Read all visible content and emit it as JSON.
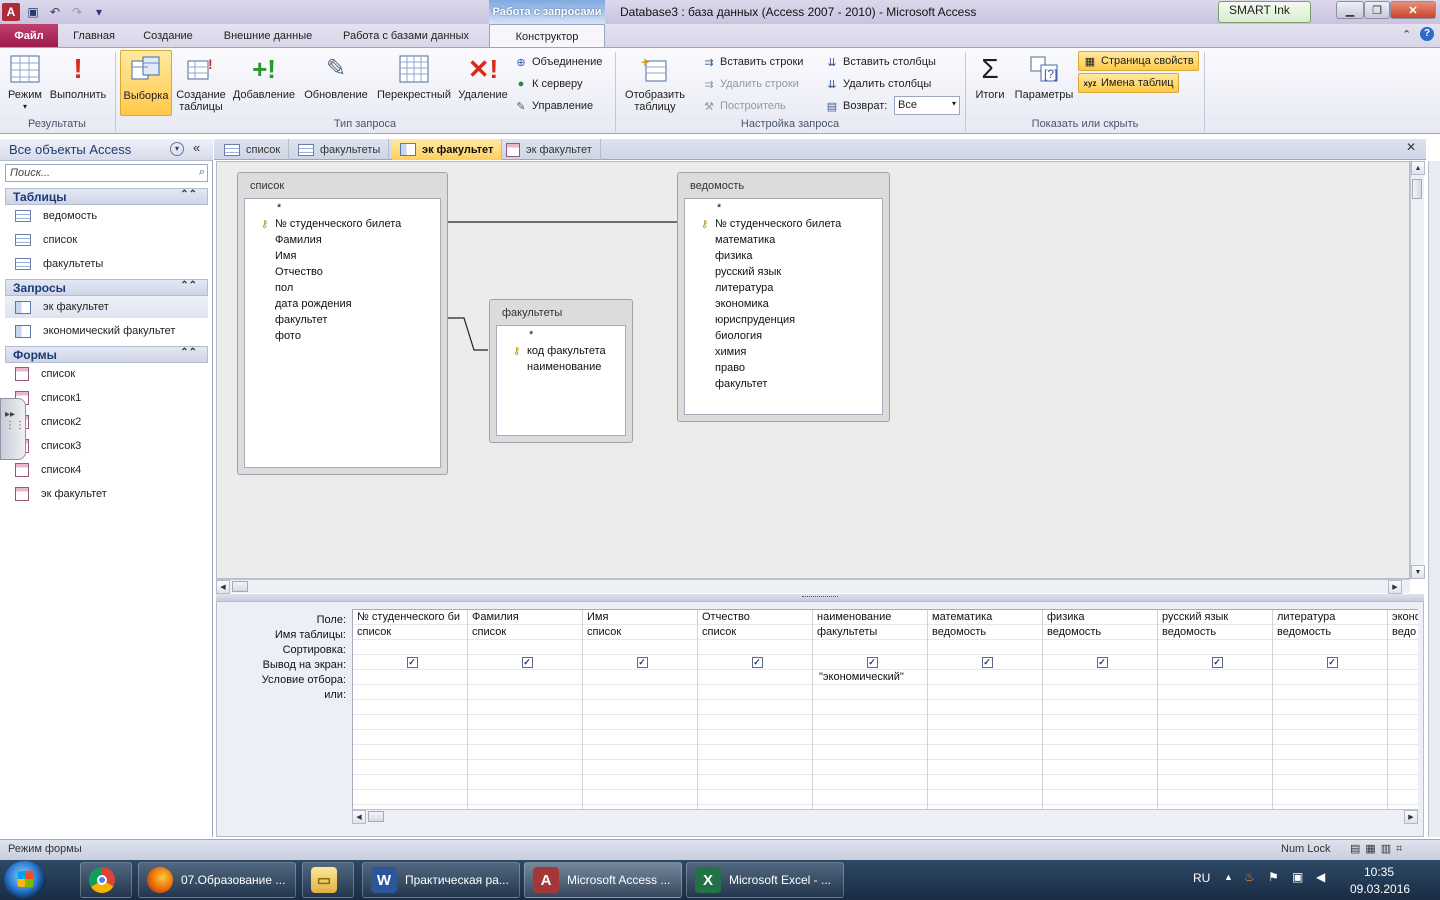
{
  "window": {
    "title": "Database3 : база данных (Access 2007 - 2010)  -  Microsoft Access",
    "smart_ink": "SMART Ink",
    "context_group": "Работа с запросами"
  },
  "ribbon_tabs": [
    "Файл",
    "Главная",
    "Создание",
    "Внешние данные",
    "Работа с базами данных",
    "Конструктор"
  ],
  "ribbon": {
    "results": {
      "label": "Результаты",
      "mode": "Режим",
      "run": "Выполнить"
    },
    "query_type": {
      "label": "Тип запроса",
      "select": "Выборка",
      "make_table_1": "Создание",
      "make_table_2": "таблицы",
      "append": "Добавление",
      "update": "Обновление",
      "crosstab": "Перекрестный",
      "delete": "Удаление",
      "union": "Объединение",
      "server": "К серверу",
      "manage": "Управление"
    },
    "setup": {
      "label": "Настройка запроса",
      "show_table_1": "Отобразить",
      "show_table_2": "таблицу",
      "insert_rows": "Вставить строки",
      "delete_rows": "Удалить строки",
      "builder": "Построитель",
      "insert_cols": "Вставить столбцы",
      "delete_cols": "Удалить столбцы",
      "return_label": "Возврат:",
      "return_value": "Все"
    },
    "show_hide": {
      "label": "Показать или скрыть",
      "totals": "Итоги",
      "params": "Параметры",
      "property_sheet": "Страница свойств",
      "table_names": "Имена таблиц"
    }
  },
  "nav": {
    "header": "Все объекты Access",
    "search_placeholder": "Поиск...",
    "groups": [
      {
        "title": "Таблицы",
        "items": [
          "ведомость",
          "список",
          "факультеты"
        ]
      },
      {
        "title": "Запросы",
        "items": [
          "эк факультет",
          "экономический факультет"
        ]
      },
      {
        "title": "Формы",
        "items": [
          "список",
          "список1",
          "список2",
          "список3",
          "список4",
          "эк факультет"
        ]
      }
    ]
  },
  "doc_tabs": [
    "список",
    "факультеты",
    "эк факультет",
    "эк факультет"
  ],
  "tables": {
    "spisok": {
      "title": "список",
      "fields": [
        "*",
        "№ студенческого билета",
        "Фамилия",
        "Имя",
        "Отчество",
        "пол",
        "дата рождения",
        "факультет",
        "фото"
      ]
    },
    "fakultety": {
      "title": "факультеты",
      "fields": [
        "*",
        "код факультета",
        "наименование"
      ]
    },
    "vedomost": {
      "title": "ведомость",
      "fields": [
        "*",
        "№ студенческого билета",
        "математика",
        "физика",
        "русский язык",
        "литература",
        "экономика",
        "юриспруденция",
        "биология",
        "химия",
        "право",
        "факультет"
      ]
    }
  },
  "grid": {
    "row_labels": [
      "Поле:",
      "Имя таблицы:",
      "Сортировка:",
      "Вывод на экран:",
      "Условие отбора:",
      "или:"
    ],
    "columns": [
      {
        "field": "№ студенческого би",
        "table": "список",
        "criteria": ""
      },
      {
        "field": "Фамилия",
        "table": "список",
        "criteria": ""
      },
      {
        "field": "Имя",
        "table": "список",
        "criteria": ""
      },
      {
        "field": "Отчество",
        "table": "список",
        "criteria": ""
      },
      {
        "field": "наименование",
        "table": "факультеты",
        "criteria": "\"экономический\""
      },
      {
        "field": "математика",
        "table": "ведомость",
        "criteria": ""
      },
      {
        "field": "физика",
        "table": "ведомость",
        "criteria": ""
      },
      {
        "field": "русский язык",
        "table": "ведомость",
        "criteria": ""
      },
      {
        "field": "литература",
        "table": "ведомость",
        "criteria": ""
      },
      {
        "field": "эконо",
        "table": "ведо",
        "criteria": ""
      }
    ]
  },
  "status": {
    "left": "Режим формы",
    "numlock": "Num Lock"
  },
  "taskbar": {
    "apps": [
      "07.Образование ...",
      "Практическая ра...",
      "Microsoft Access ...",
      "Microsoft Excel - ..."
    ],
    "lang": "RU",
    "time": "10:35",
    "date": "09.03.2016"
  },
  "colors": {
    "accent": "#1d3a78",
    "file_tab": "#b03060",
    "highlight": "#ffcf5c"
  }
}
